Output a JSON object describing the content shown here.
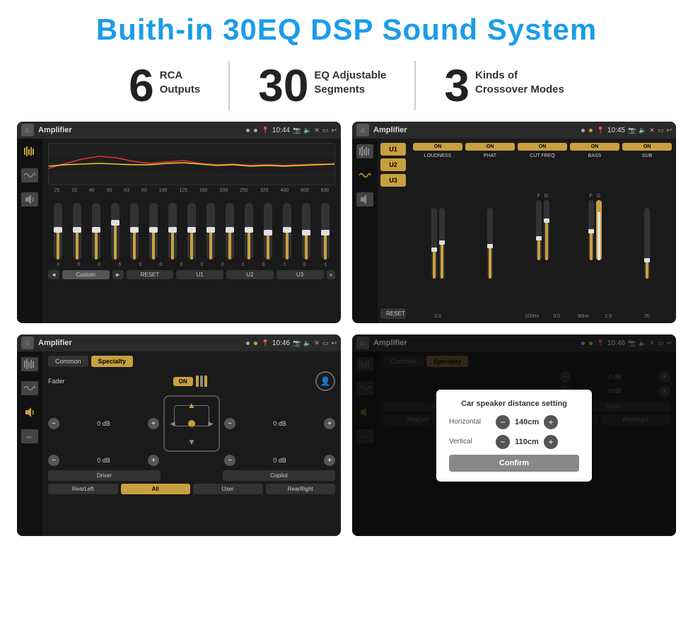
{
  "header": {
    "title": "Buith-in 30EQ DSP Sound System"
  },
  "stats": [
    {
      "number": "6",
      "line1": "RCA",
      "line2": "Outputs"
    },
    {
      "number": "30",
      "line1": "EQ Adjustable",
      "line2": "Segments"
    },
    {
      "number": "3",
      "line1": "Kinds of",
      "line2": "Crossover Modes"
    }
  ],
  "screens": [
    {
      "id": "eq-screen",
      "time": "10:44",
      "title": "Amplifier",
      "eq_labels": [
        "25",
        "32",
        "40",
        "50",
        "63",
        "80",
        "100",
        "125",
        "160",
        "200",
        "250",
        "320",
        "400",
        "500",
        "630"
      ],
      "eq_values": [
        "0",
        "0",
        "0",
        "5",
        "0",
        "0",
        "0",
        "0",
        "0",
        "0",
        "0",
        "-1",
        "0",
        "-1"
      ],
      "buttons": [
        "◄",
        "Custom",
        "►",
        "RESET",
        "U1",
        "U2",
        "U3"
      ]
    },
    {
      "id": "crossover-screen",
      "time": "10:45",
      "title": "Amplifier",
      "presets": [
        "U1",
        "U2",
        "U3"
      ],
      "controls": [
        "LOUDNESS",
        "PHAT",
        "CUT FREQ",
        "BASS",
        "SUB"
      ],
      "reset_label": "RESET"
    },
    {
      "id": "fader-screen",
      "time": "10:46",
      "title": "Amplifier",
      "tabs": [
        "Common",
        "Specialty"
      ],
      "fader_label": "Fader",
      "fader_on": "ON",
      "volumes": [
        "0 dB",
        "0 dB",
        "0 dB",
        "0 dB"
      ],
      "bottom_btns": [
        "Driver",
        "Copilot",
        "RearLeft",
        "All",
        "User",
        "RearRight"
      ]
    },
    {
      "id": "dialog-screen",
      "time": "10:46",
      "title": "Amplifier",
      "tabs": [
        "Common",
        "Specialty"
      ],
      "dialog": {
        "title": "Car speaker distance setting",
        "horizontal_label": "Horizontal",
        "horizontal_value": "140cm",
        "vertical_label": "Vertical",
        "vertical_value": "110cm",
        "confirm_label": "Confirm"
      },
      "right_volumes": [
        "0 dB",
        "0 dB"
      ],
      "bottom_btns": [
        "Driver",
        "Copilot",
        "RearLeft",
        "All",
        "User",
        "RearRight"
      ]
    }
  ]
}
